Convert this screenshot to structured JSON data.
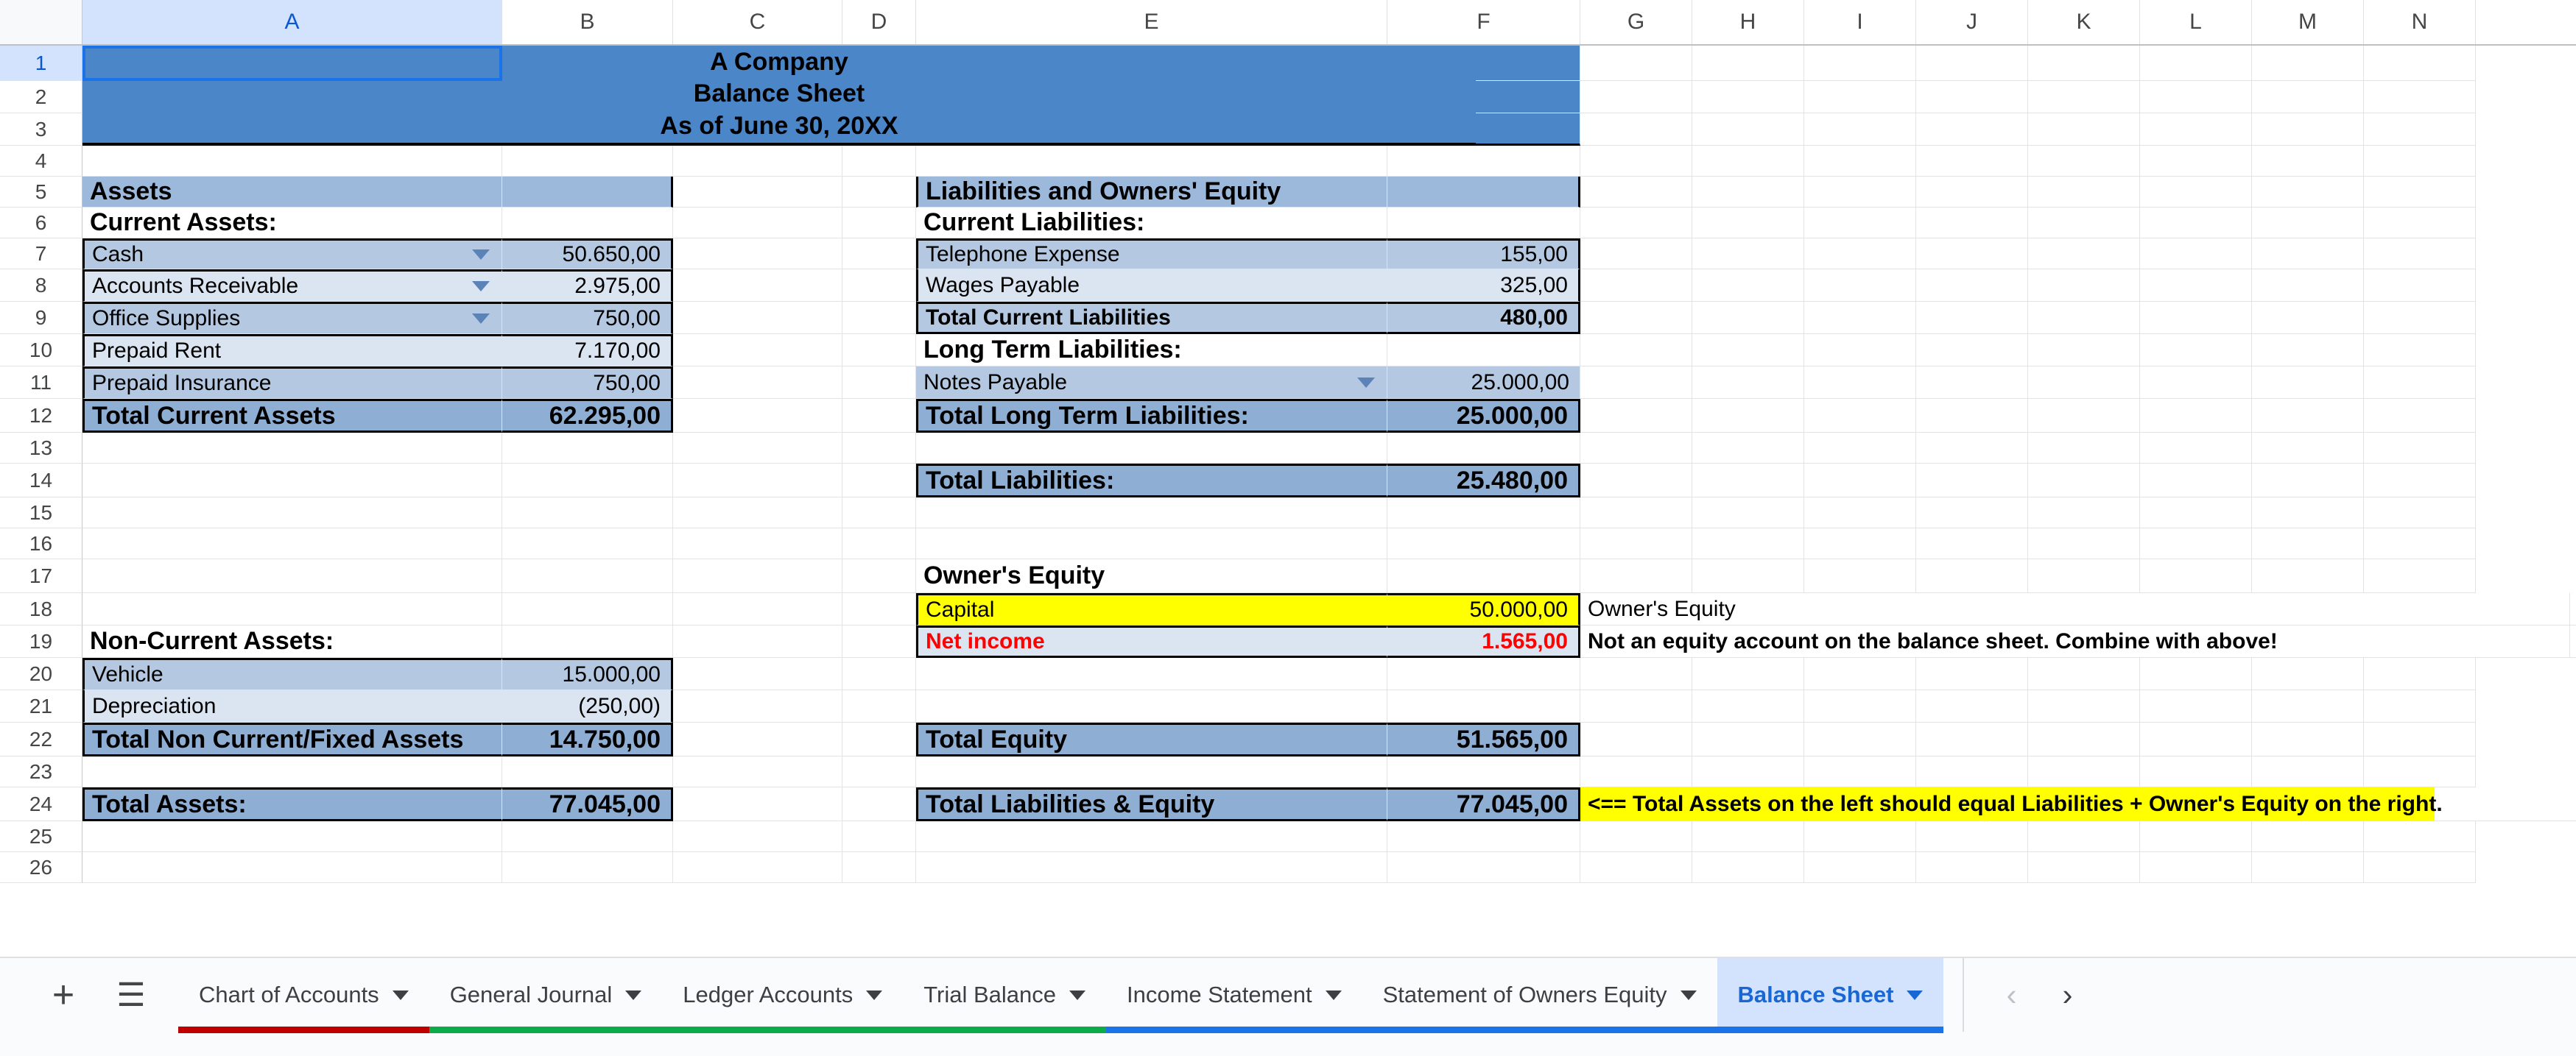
{
  "grid": {
    "columns": [
      "A",
      "B",
      "C",
      "D",
      "E",
      "F",
      "G",
      "H",
      "I",
      "J",
      "K",
      "L",
      "M",
      "N"
    ],
    "rows": [
      "1",
      "2",
      "3",
      "4",
      "5",
      "6",
      "7",
      "8",
      "9",
      "10",
      "11",
      "12",
      "13",
      "14",
      "15",
      "16",
      "17",
      "18",
      "19",
      "20",
      "21",
      "22",
      "23",
      "24",
      "25",
      "26"
    ],
    "selected_cell": "A1"
  },
  "title": {
    "line1": "A Company",
    "line2": "Balance Sheet",
    "line3": "As of June 30, 20XX"
  },
  "assets": {
    "section_header": "Assets",
    "current_header": "Current Assets:",
    "rows": [
      {
        "row": "7",
        "label": "Cash",
        "value": "50.650,00",
        "dropdown": true
      },
      {
        "row": "8",
        "label": "Accounts Receivable",
        "value": "2.975,00",
        "dropdown": true
      },
      {
        "row": "9",
        "label": "Office Supplies",
        "value": "750,00",
        "dropdown": true
      },
      {
        "row": "10",
        "label": "Prepaid Rent",
        "value": "7.170,00",
        "dropdown": false
      },
      {
        "row": "11",
        "label": "Prepaid Insurance",
        "value": "750,00",
        "dropdown": false
      }
    ],
    "total_current_label": "Total Current Assets",
    "total_current_value": "62.295,00",
    "noncurrent_header": "Non-Current Assets:",
    "noncurrent_rows": [
      {
        "row": "20",
        "label": "Vehicle",
        "value": "15.000,00"
      },
      {
        "row": "21",
        "label": "Depreciation",
        "value": "(250,00)"
      }
    ],
    "total_noncurrent_label": "Total Non Current/Fixed Assets",
    "total_noncurrent_value": "14.750,00",
    "total_assets_label": "Total Assets:",
    "total_assets_value": "77.045,00"
  },
  "liabilities": {
    "section_header": "Liabilities and Owners' Equity",
    "current_header": "Current Liabilities:",
    "rows": [
      {
        "row": "7",
        "label": "Telephone Expense",
        "value": "155,00",
        "dropdown": false
      },
      {
        "row": "8",
        "label": "Wages Payable",
        "value": "325,00",
        "dropdown": false
      }
    ],
    "total_current_label": "Total Current Liabilities",
    "total_current_value": "480,00",
    "longterm_header": "Long Term Liabilities:",
    "longterm_rows": [
      {
        "row": "11",
        "label": "Notes Payable",
        "value": "25.000,00",
        "dropdown": true
      }
    ],
    "total_longterm_label": "Total Long Term Liabilities:",
    "total_longterm_value": "25.000,00",
    "total_liabilities_label": "Total Liabilities:",
    "total_liabilities_value": "25.480,00"
  },
  "equity": {
    "header": "Owner's Equity",
    "rows": [
      {
        "row": "18",
        "label": "Capital",
        "value": "50.000,00",
        "note": "Owner's Equity"
      },
      {
        "row": "19",
        "label": "Net income",
        "value": "1.565,00",
        "note": "Not an equity account on the balance sheet. Combine with above!"
      }
    ],
    "total_label": "Total Equity",
    "total_value": "51.565,00",
    "total_le_label": "Total Liabilities & Equity",
    "total_le_value": "77.045,00",
    "balance_note": "<== Total Assets on the left should equal Liabilities + Owner's Equity on the right."
  },
  "tabbar": {
    "add_label": "+",
    "all_sheets_label": "☰",
    "tabs": [
      {
        "label": "Chart of Accounts",
        "color": "#c00000",
        "active": false
      },
      {
        "label": "General Journal",
        "color": "#0cab4a",
        "active": false
      },
      {
        "label": "Ledger Accounts",
        "color": "#0cab4a",
        "active": false
      },
      {
        "label": "Trial Balance",
        "color": "#0cab4a",
        "active": false
      },
      {
        "label": "Income Statement",
        "color": "#1a73e8",
        "active": false
      },
      {
        "label": "Statement of Owners Equity",
        "color": "#1a73e8",
        "active": false
      },
      {
        "label": "Balance Sheet",
        "color": "#1a73e8",
        "active": true
      }
    ],
    "prev_label": "‹",
    "next_label": "›"
  },
  "colors": {
    "title_fill": "#4a86c8",
    "section_fill": "#9cb9dc",
    "total_fill": "#8faed3",
    "band_dark": "#b4c8e1",
    "band_light": "#dbe5f1",
    "highlight": "#ffff00",
    "negative": "#ff0000",
    "accent": "#1a73e8"
  }
}
